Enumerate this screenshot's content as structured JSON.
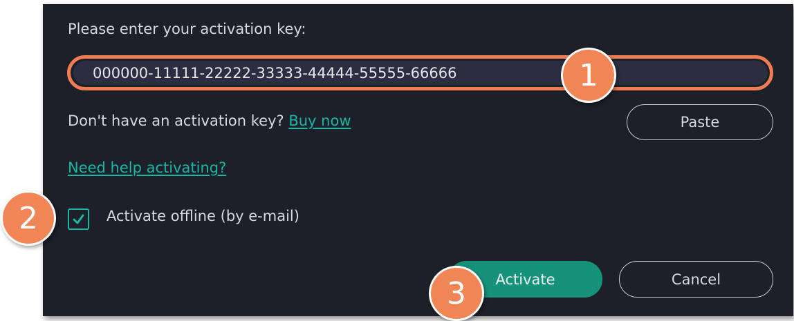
{
  "dialog": {
    "prompt_label": "Please enter your activation key:",
    "key_value": "000000-11111-22222-33333-44444-55555-66666",
    "no_key_text": "Don't have an activation key?",
    "buy_now_link": "Buy now",
    "paste_button": "Paste",
    "help_link": "Need help activating?",
    "offline_checkbox": {
      "label": "Activate offline (by e-mail)",
      "checked": true
    },
    "activate_button": "Activate",
    "cancel_button": "Cancel"
  },
  "callouts": [
    "1",
    "2",
    "3"
  ],
  "colors": {
    "background": "#1d1f29",
    "input_bg": "#2b2e41",
    "accent_teal": "#19b7a8",
    "primary_button": "#17927a",
    "callout_orange": "#f08656",
    "highlight_outline": "#f07c52"
  },
  "icons": {
    "checkbox": "checkmark-icon"
  }
}
